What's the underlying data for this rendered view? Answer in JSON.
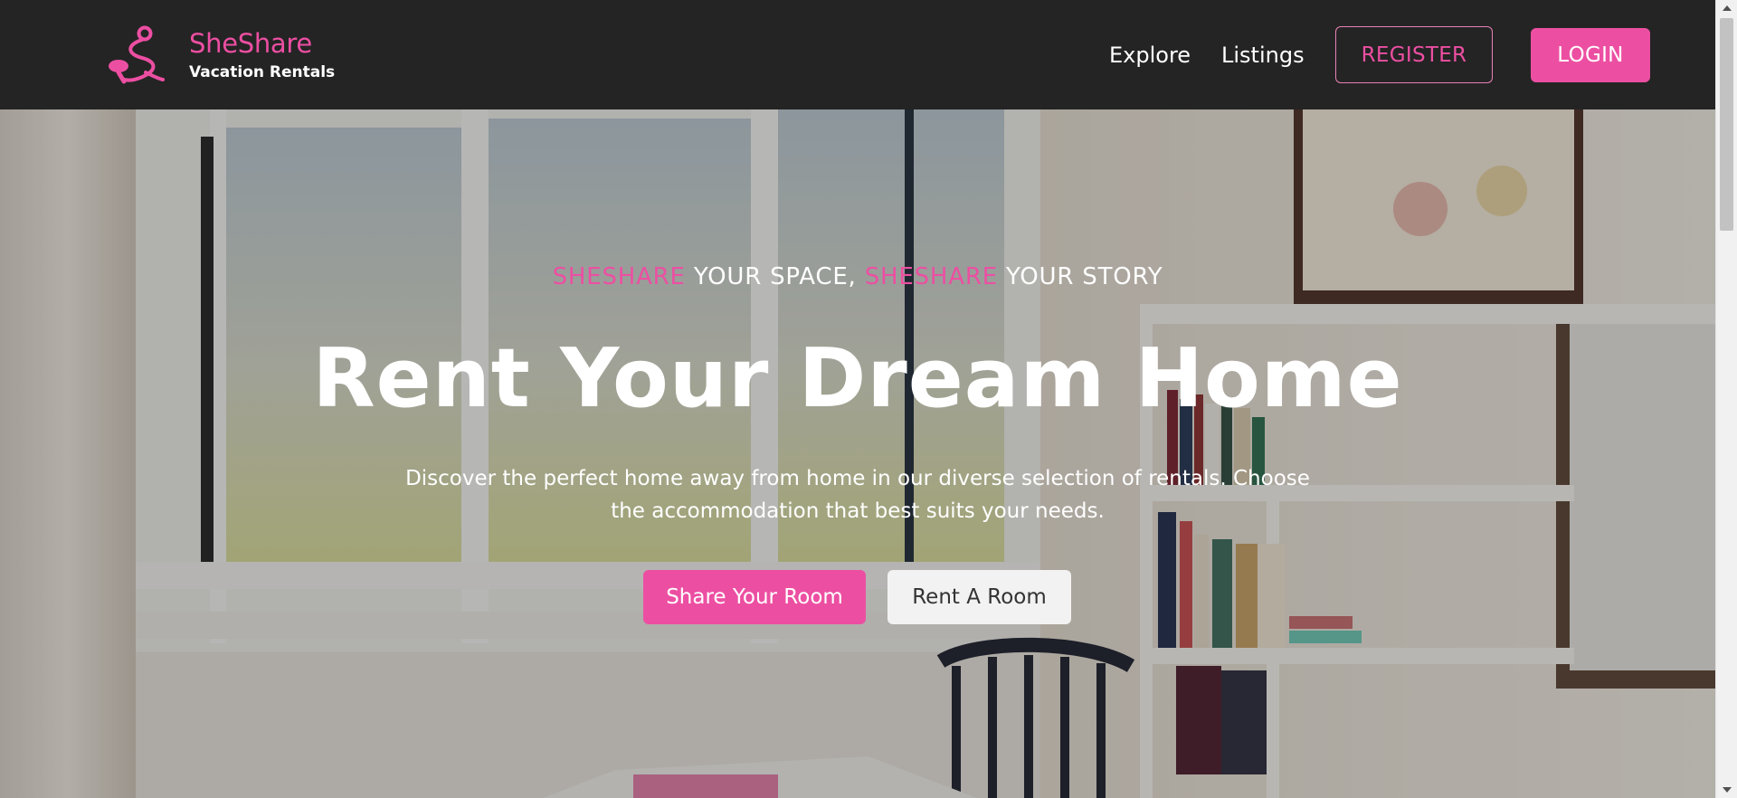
{
  "brand": {
    "name": "SheShare",
    "tagline": "Vacation Rentals",
    "logo_icon": "sheshare-logo-icon",
    "color": "#ec4fa2"
  },
  "nav": {
    "links": [
      {
        "label": "Explore"
      },
      {
        "label": "Listings"
      }
    ],
    "register_label": "REGISTER",
    "login_label": "LOGIN"
  },
  "hero": {
    "kicker": {
      "part1_accent": "SHESHARE",
      "part2": " YOUR SPACE, ",
      "part3_accent": "SHESHARE",
      "part4": " YOUR STORY"
    },
    "title": "Rent Your Dream Home",
    "subtitle": "Discover the perfect home away from home in our diverse selection of rentals. Choose the accommodation that best suits your needs.",
    "primary_cta": "Share Your Room",
    "secondary_cta": "Rent A Room",
    "background": "room-interior-photo"
  },
  "colors": {
    "accent": "#ec4fa2",
    "header_bg": "#242424",
    "secondary_button_bg": "#f2f2f2"
  }
}
